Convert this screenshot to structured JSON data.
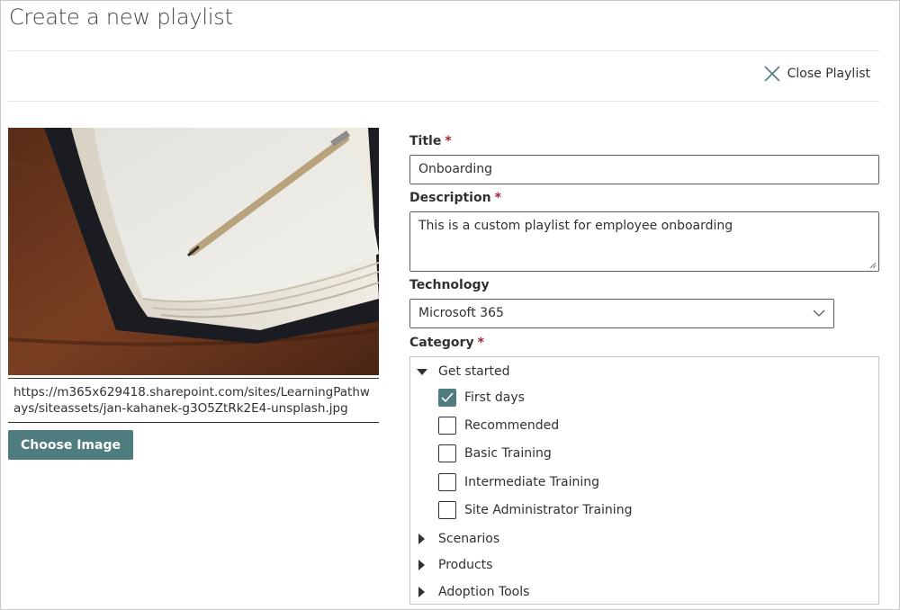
{
  "page": {
    "title": "Create a new playlist"
  },
  "toolbar": {
    "close_label": "Close Playlist",
    "close_icon": "close-icon"
  },
  "image": {
    "url": "https://m365x629418.sharepoint.com/sites/LearningPathways/siteassets/jan-kahanek-g3O5ZtRk2E4-unsplash.jpg",
    "choose_label": "Choose Image"
  },
  "form": {
    "title_label": "Title",
    "title_value": "Onboarding",
    "description_label": "Description",
    "description_value": "This is a custom playlist for employee onboarding",
    "technology_label": "Technology",
    "technology_value": "Microsoft 365",
    "category_label": "Category",
    "required_marker": "*"
  },
  "categories": [
    {
      "label": "Get started",
      "expanded": true,
      "children": [
        {
          "label": "First days",
          "checked": true
        },
        {
          "label": "Recommended",
          "checked": false
        },
        {
          "label": "Basic Training",
          "checked": false
        },
        {
          "label": "Intermediate Training",
          "checked": false
        },
        {
          "label": "Site Administrator Training",
          "checked": false
        }
      ]
    },
    {
      "label": "Scenarios",
      "expanded": false
    },
    {
      "label": "Products",
      "expanded": false
    },
    {
      "label": "Adoption Tools",
      "expanded": false
    }
  ],
  "colors": {
    "accent": "#4f7c7f",
    "required": "#a4262c",
    "text": "#323130"
  }
}
